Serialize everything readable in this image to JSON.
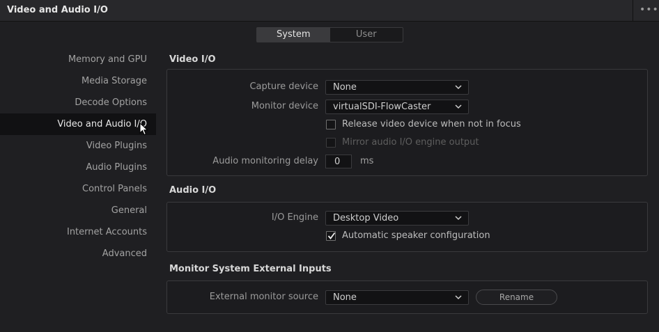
{
  "window": {
    "title": "Video and Audio I/O",
    "menu_glyph": "•••"
  },
  "tabs": [
    {
      "label": "System",
      "active": true
    },
    {
      "label": "User",
      "active": false
    }
  ],
  "sidebar": {
    "items": [
      {
        "label": "Memory and GPU"
      },
      {
        "label": "Media Storage"
      },
      {
        "label": "Decode Options"
      },
      {
        "label": "Video and Audio I/O",
        "active": true
      },
      {
        "label": "Video Plugins"
      },
      {
        "label": "Audio Plugins"
      },
      {
        "label": "Control Panels"
      },
      {
        "label": "General"
      },
      {
        "label": "Internet Accounts"
      },
      {
        "label": "Advanced"
      }
    ]
  },
  "video_io": {
    "title": "Video I/O",
    "capture_device": {
      "label": "Capture device",
      "value": "None"
    },
    "monitor_device": {
      "label": "Monitor device",
      "value": "virtualSDI-FlowCaster"
    },
    "release_device": {
      "label": "Release video device when not in focus",
      "checked": false
    },
    "mirror_audio": {
      "label": "Mirror audio I/O engine output",
      "checked": false,
      "disabled": true
    },
    "audio_delay": {
      "label": "Audio monitoring delay",
      "value": "0",
      "unit": "ms"
    }
  },
  "audio_io": {
    "title": "Audio I/O",
    "io_engine": {
      "label": "I/O Engine",
      "value": "Desktop Video"
    },
    "auto_speaker": {
      "label": "Automatic speaker configuration",
      "checked": true
    }
  },
  "external_inputs": {
    "title": "Monitor System External Inputs",
    "source": {
      "label": "External monitor source",
      "value": "None"
    },
    "rename_button": "Rename"
  },
  "colors": {
    "accent_bg": "#111113",
    "panel_bg": "#1c1c1f",
    "text": "#bdbdbd"
  }
}
